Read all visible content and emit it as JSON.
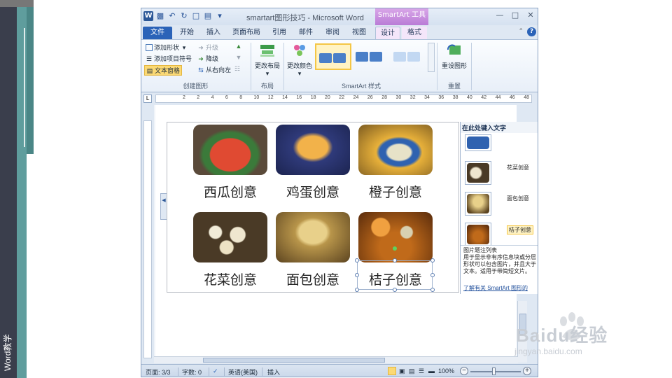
{
  "slide": {
    "side_label": "Word教学"
  },
  "window": {
    "title": "smartart图形技巧 - Microsoft Word",
    "context_tab_header": "SmartArt 工具"
  },
  "tabs": [
    {
      "label": "文件"
    },
    {
      "label": "开始"
    },
    {
      "label": "插入"
    },
    {
      "label": "页面布局"
    },
    {
      "label": "引用"
    },
    {
      "label": "邮件"
    },
    {
      "label": "审阅"
    },
    {
      "label": "视图"
    },
    {
      "label": "设计"
    },
    {
      "label": "格式"
    }
  ],
  "ribbon": {
    "create": {
      "add_shape": "添加形状",
      "add_bullet": "添加项目符号",
      "text_pane": "文本窗格",
      "promote": "升级",
      "demote": "降级",
      "right_to_left": "从右向左",
      "group_label": "创建图形"
    },
    "layouts": {
      "change_layout": "更改布局",
      "group_label": "布局"
    },
    "styles": {
      "change_colors": "更改颜色",
      "group_label": "SmartArt 样式"
    },
    "reset": {
      "reset_graphic": "重设图形",
      "group_label": "重置"
    }
  },
  "ruler": {
    "numbers": [
      "2",
      "2",
      "4",
      "6",
      "8",
      "10",
      "12",
      "14",
      "16",
      "18",
      "20",
      "22",
      "24",
      "26",
      "28",
      "30",
      "32",
      "34",
      "36",
      "38",
      "40",
      "42",
      "44",
      "46",
      "48"
    ]
  },
  "smartart": {
    "items": [
      {
        "caption": "西瓜创意",
        "image": "watermelon-photo"
      },
      {
        "caption": "鸡蛋创意",
        "image": "egg-photo"
      },
      {
        "caption": "橙子创意",
        "image": "orange-photo"
      },
      {
        "caption": "花菜创意",
        "image": "cauliflower-photo"
      },
      {
        "caption": "面包创意",
        "image": "bread-photo"
      },
      {
        "caption": "桔子创意",
        "image": "tangerine-photo"
      }
    ]
  },
  "text_pane": {
    "header": "在此处键入文字",
    "bullets": [
      "花菜创意",
      "面包创意",
      "桔子创意"
    ],
    "desc_title": "图片题注列表",
    "desc_body": "用于显示非有序信息块或分层形状可以包含图片，并且大于文本。适用于带简短文片。",
    "learn_more": "了解有关 SmartArt 图形的"
  },
  "statusbar": {
    "page": "页面: 3/3",
    "words": "字数: 0",
    "language": "英语(美国)",
    "mode": "插入",
    "zoom": "100%"
  },
  "watermark": {
    "brand": "Baidu经验",
    "url": "jingyan.baidu.com"
  }
}
